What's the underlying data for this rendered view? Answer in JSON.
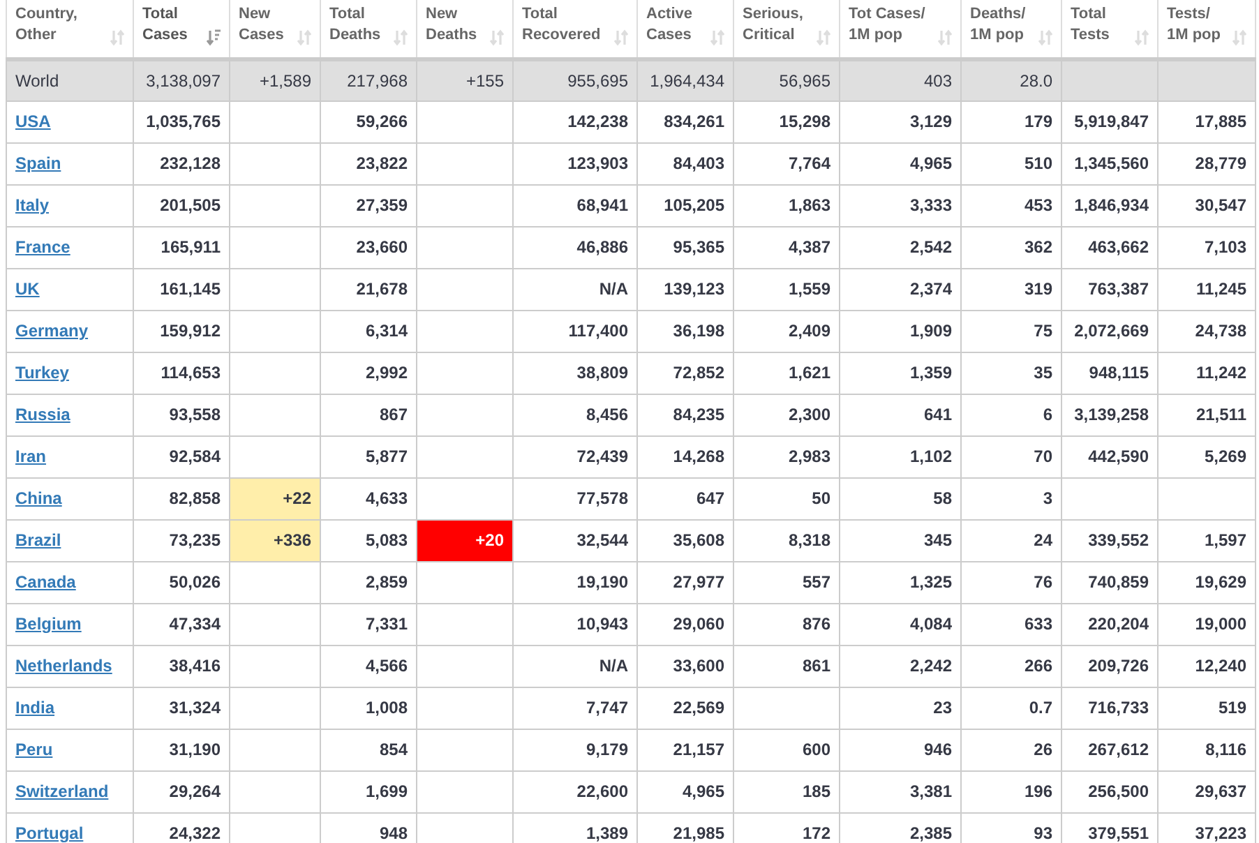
{
  "table": {
    "columns": [
      {
        "label": "Country, Other",
        "sorted": false,
        "kind": "name"
      },
      {
        "label": "Total Cases",
        "sorted": true
      },
      {
        "label": "New Cases",
        "sorted": false,
        "kind": "change",
        "color": "#ffeeaa"
      },
      {
        "label": "Total Deaths",
        "sorted": false
      },
      {
        "label": "New Deaths",
        "sorted": false,
        "kind": "alert",
        "color": "#ff0000"
      },
      {
        "label": "Total Recovered",
        "sorted": false
      },
      {
        "label": "Active Cases",
        "sorted": false
      },
      {
        "label": "Serious, Critical",
        "sorted": false
      },
      {
        "label": "Tot Cases/ 1M pop",
        "sorted": false
      },
      {
        "label": "Deaths/ 1M pop",
        "sorted": false
      },
      {
        "label": "Total Tests",
        "sorted": false
      },
      {
        "label": "Tests/ 1M pop",
        "sorted": false
      }
    ],
    "rows": [
      {
        "kind": "total",
        "cells": [
          "World",
          "3,138,097",
          "+1,589",
          "217,968",
          "+155",
          "955,695",
          "1,964,434",
          "56,965",
          "403",
          "28.0",
          null,
          null
        ]
      },
      {
        "kind": "country",
        "cells": [
          "USA",
          "1,035,765",
          null,
          "59,266",
          null,
          "142,238",
          "834,261",
          "15,298",
          "3,129",
          "179",
          "5,919,847",
          "17,885"
        ]
      },
      {
        "kind": "country",
        "cells": [
          "Spain",
          "232,128",
          null,
          "23,822",
          null,
          "123,903",
          "84,403",
          "7,764",
          "4,965",
          "510",
          "1,345,560",
          "28,779"
        ]
      },
      {
        "kind": "country",
        "cells": [
          "Italy",
          "201,505",
          null,
          "27,359",
          null,
          "68,941",
          "105,205",
          "1,863",
          "3,333",
          "453",
          "1,846,934",
          "30,547"
        ]
      },
      {
        "kind": "country",
        "cells": [
          "France",
          "165,911",
          null,
          "23,660",
          null,
          "46,886",
          "95,365",
          "4,387",
          "2,542",
          "362",
          "463,662",
          "7,103"
        ]
      },
      {
        "kind": "country",
        "cells": [
          "UK",
          "161,145",
          null,
          "21,678",
          null,
          "N/A",
          "139,123",
          "1,559",
          "2,374",
          "319",
          "763,387",
          "11,245"
        ]
      },
      {
        "kind": "country",
        "cells": [
          "Germany",
          "159,912",
          null,
          "6,314",
          null,
          "117,400",
          "36,198",
          "2,409",
          "1,909",
          "75",
          "2,072,669",
          "24,738"
        ]
      },
      {
        "kind": "country",
        "cells": [
          "Turkey",
          "114,653",
          null,
          "2,992",
          null,
          "38,809",
          "72,852",
          "1,621",
          "1,359",
          "35",
          "948,115",
          "11,242"
        ]
      },
      {
        "kind": "country",
        "cells": [
          "Russia",
          "93,558",
          null,
          "867",
          null,
          "8,456",
          "84,235",
          "2,300",
          "641",
          "6",
          "3,139,258",
          "21,511"
        ]
      },
      {
        "kind": "country",
        "cells": [
          "Iran",
          "92,584",
          null,
          "5,877",
          null,
          "72,439",
          "14,268",
          "2,983",
          "1,102",
          "70",
          "442,590",
          "5,269"
        ]
      },
      {
        "kind": "country",
        "cells": [
          "China",
          "82,858",
          "+22",
          "4,633",
          null,
          "77,578",
          "647",
          "50",
          "58",
          "3",
          null,
          null
        ]
      },
      {
        "kind": "country",
        "cells": [
          "Brazil",
          "73,235",
          "+336",
          "5,083",
          "+20",
          "32,544",
          "35,608",
          "8,318",
          "345",
          "24",
          "339,552",
          "1,597"
        ]
      },
      {
        "kind": "country",
        "cells": [
          "Canada",
          "50,026",
          null,
          "2,859",
          null,
          "19,190",
          "27,977",
          "557",
          "1,325",
          "76",
          "740,859",
          "19,629"
        ]
      },
      {
        "kind": "country",
        "cells": [
          "Belgium",
          "47,334",
          null,
          "7,331",
          null,
          "10,943",
          "29,060",
          "876",
          "4,084",
          "633",
          "220,204",
          "19,000"
        ]
      },
      {
        "kind": "country",
        "cells": [
          "Netherlands",
          "38,416",
          null,
          "4,566",
          null,
          "N/A",
          "33,600",
          "861",
          "2,242",
          "266",
          "209,726",
          "12,240"
        ]
      },
      {
        "kind": "country",
        "cells": [
          "India",
          "31,324",
          null,
          "1,008",
          null,
          "7,747",
          "22,569",
          null,
          "23",
          "0.7",
          "716,733",
          "519"
        ]
      },
      {
        "kind": "country",
        "cells": [
          "Peru",
          "31,190",
          null,
          "854",
          null,
          "9,179",
          "21,157",
          "600",
          "946",
          "26",
          "267,612",
          "8,116"
        ]
      },
      {
        "kind": "country",
        "cells": [
          "Switzerland",
          "29,264",
          null,
          "1,699",
          null,
          "22,600",
          "4,965",
          "185",
          "3,381",
          "196",
          "256,500",
          "29,637"
        ]
      },
      {
        "kind": "country",
        "cells": [
          "Portugal",
          "24,322",
          null,
          "948",
          null,
          "1,389",
          "21,985",
          "172",
          "2,385",
          "93",
          "379,551",
          "37,223"
        ]
      }
    ]
  }
}
